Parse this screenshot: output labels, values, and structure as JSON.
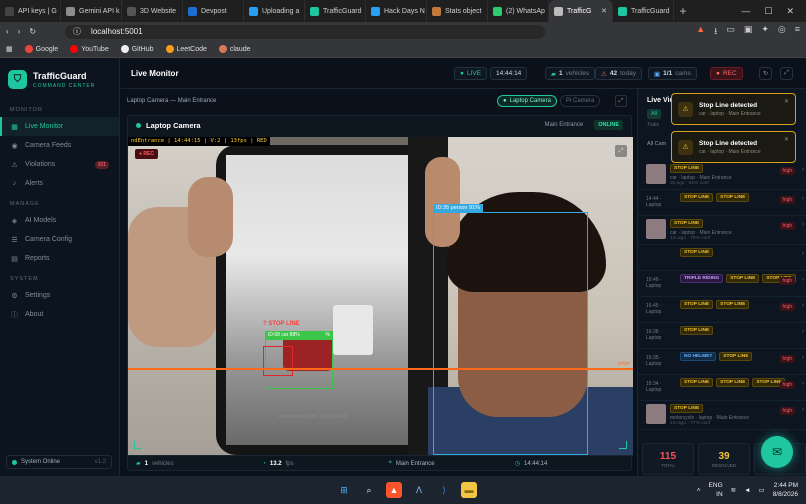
{
  "browser": {
    "tabs": [
      {
        "label": "API keys | G",
        "color": "#444"
      },
      {
        "label": "Gemini API k",
        "color": "#8c8c8c"
      },
      {
        "label": "3D Website",
        "color": "#555"
      },
      {
        "label": "Devpost",
        "color": "#1c6fd1"
      },
      {
        "label": "Uploading a",
        "color": "#2a9df4"
      },
      {
        "label": "TrafficGuard",
        "color": "#1fc7a0"
      },
      {
        "label": "Hack Days N",
        "color": "#2a9df4"
      },
      {
        "label": "Stats object",
        "color": "#c27a3b"
      },
      {
        "label": "(2) WhatsAp",
        "color": "#2ecc71"
      },
      {
        "label": "TrafficG",
        "color": "#bbb"
      },
      {
        "label": "TrafficGuard",
        "color": "#1fc7a0"
      }
    ],
    "url": "localhost:5001",
    "bookmarks": [
      {
        "label": "Google",
        "color": "#e8453c"
      },
      {
        "label": "YouTube",
        "color": "#ff0000"
      },
      {
        "label": "GitHub",
        "color": "#eee"
      },
      {
        "label": "LeetCode",
        "color": "#f89f1b"
      },
      {
        "label": "claude",
        "color": "#d97757"
      }
    ]
  },
  "app": {
    "brand": "TrafficGuard",
    "brand_sub": "COMMAND CENTER",
    "sections": {
      "monitor": "MONITOR",
      "manage": "MANAGE",
      "system": "SYSTEM"
    },
    "nav": {
      "live": "Live Monitor",
      "feeds": "Camera Feeds",
      "violations": "Violations",
      "violations_badge": "101",
      "alerts": "Alerts",
      "models": "AI Models",
      "config": "Camera Config",
      "reports": "Reports",
      "settings": "Settings",
      "about": "About"
    },
    "system_status": "System Online",
    "version": "v1.2",
    "page_title": "Live Monitor",
    "live_label": "LIVE",
    "time": "14:44:14",
    "vehicles": "1",
    "vehicles_label": "vehicles",
    "today": "42",
    "today_label": "today",
    "cams": "1/1",
    "cams_label": "cams",
    "rec_btn": "REC",
    "crumb": "Laptop Camera — Main Entrance",
    "cam_tab1": "Laptop Camera",
    "cam_tab2": "Pi Camera",
    "camera_name": "Laptop Camera",
    "camera_location": "Main Entrance",
    "online": "ONLINE",
    "osd": "ndEntrance | 14:44:15 | V:2 | 13fps | RED",
    "rec": "● REC",
    "person_label": "ID:35 person 91%",
    "car_label": "ID:68 car 88%",
    "car_label_tail": "%",
    "stop_alert": "? STOP LINE",
    "stop_line_tag": "STOP",
    "shutterstock": "shutterstock.com · 2335787047",
    "footer": {
      "vehicles": "1",
      "vehicles_label": "vehicles",
      "fps": "13.2",
      "fps_label": "fps",
      "location": "Main Entrance",
      "time": "14:44:14"
    },
    "right": {
      "title": "Live Vid",
      "all": "All",
      "trials": "Trials",
      "all_cameras": "All Cam",
      "events": [
        {
          "time": "",
          "tags": [
            {
              "t": "STOP LINE",
              "c": "y"
            }
          ],
          "meta": "car · laptop · Main Entrance",
          "ago": "3s ago · 61% conf",
          "thumb": true
        },
        {
          "time": "14:44 · Laptop",
          "tags": [
            {
              "t": "STOP LINE",
              "c": "y"
            },
            {
              "t": "STOP LINE",
              "c": "y"
            }
          ],
          "meta": "",
          "ago": "",
          "thumb": false
        },
        {
          "time": "",
          "tags": [
            {
              "t": "STOP LINE",
              "c": "y"
            }
          ],
          "meta": "car · laptop · Main Entrance",
          "ago": "1m ago · 79% conf",
          "thumb": true
        },
        {
          "time": "",
          "tags": [
            {
              "t": "STOP LINE",
              "c": "y"
            }
          ],
          "meta": "",
          "ago": "",
          "thumb": false
        },
        {
          "time": "16:46 · Laptop",
          "tags": [
            {
              "t": "TRIPLE RIDING",
              "c": "p"
            },
            {
              "t": "STOP LINE",
              "c": "y"
            },
            {
              "t": "STOP LINE",
              "c": "y"
            }
          ],
          "meta": "",
          "ago": "",
          "thumb": false
        },
        {
          "time": "16:45 · Laptop",
          "tags": [
            {
              "t": "STOP LINE",
              "c": "y"
            },
            {
              "t": "STOP LINE",
              "c": "y"
            }
          ],
          "meta": "",
          "ago": "",
          "thumb": false
        },
        {
          "time": "16:38 · Laptop",
          "tags": [
            {
              "t": "STOP LINE",
              "c": "y"
            }
          ],
          "meta": "",
          "ago": "",
          "thumb": false
        },
        {
          "time": "16:35 · Laptop",
          "tags": [
            {
              "t": "NO HELMET",
              "c": "b"
            },
            {
              "t": "STOP LINE",
              "c": "y"
            }
          ],
          "meta": "",
          "ago": "",
          "thumb": false
        },
        {
          "time": "16:34 · Laptop",
          "tags": [
            {
              "t": "STOP LINE",
              "c": "y"
            },
            {
              "t": "STOP LINE",
              "c": "y"
            },
            {
              "t": "STOP LINE",
              "c": "y"
            }
          ],
          "meta": "",
          "ago": "",
          "thumb": false
        },
        {
          "time": "",
          "tags": [
            {
              "t": "STOP LINE",
              "c": "y"
            }
          ],
          "meta": "motorcycle · laptop · Main Entrance",
          "ago": "1m ago · 77% conf",
          "thumb": true
        },
        {
          "time": "",
          "tags": [
            {
              "t": "NO HELMET",
              "c": "b"
            }
          ],
          "meta": "",
          "ago": "",
          "thumb": false
        },
        {
          "time": "16:48 · Laptop",
          "tags": [
            {
              "t": "STOP LINE",
              "c": "y"
            }
          ],
          "meta": "",
          "ago": "",
          "thumb": false
        },
        {
          "time": "",
          "tags": [
            {
              "t": "STOP LINE",
              "c": "y"
            }
          ],
          "meta": "",
          "ago": "",
          "thumb": false
        }
      ],
      "high": "high",
      "stats": [
        {
          "n": "115",
          "l": "TOTAL",
          "color": "#ff4d5e"
        },
        {
          "n": "39",
          "l": "RESOLVED",
          "color": "#f0c233"
        },
        {
          "n": "",
          "l": "",
          "color": "#1fc7a0"
        }
      ]
    },
    "toasts": [
      {
        "title": "Stop Line detected",
        "sub": "car · laptop · Main Entrance"
      },
      {
        "title": "Stop Line detected",
        "sub": "car · laptop · Main Entrance"
      }
    ]
  },
  "taskbar": {
    "lang": "ENG",
    "region": "IN",
    "time": "2:44 PM",
    "date": "8/8/2026"
  }
}
